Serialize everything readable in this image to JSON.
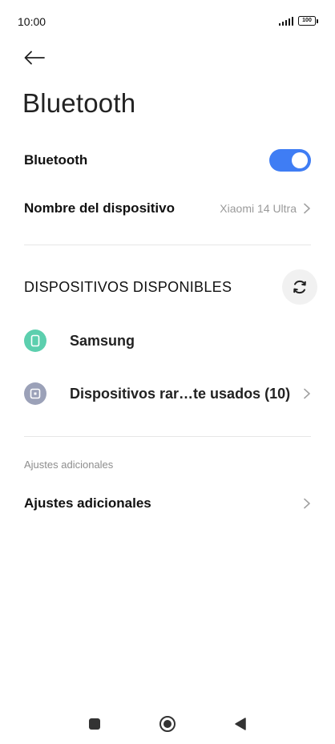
{
  "status_bar": {
    "time": "10:00",
    "battery": "100"
  },
  "header": {
    "title": "Bluetooth"
  },
  "bluetooth_toggle": {
    "label": "Bluetooth",
    "enabled": true,
    "accent": "#3f7df4"
  },
  "device_name_row": {
    "label": "Nombre del dispositivo",
    "value": "Xiaomi 14 Ultra"
  },
  "available_devices": {
    "title": "DISPOSITIVOS DISPONIBLES",
    "items": [
      {
        "name": "Samsung",
        "icon": "phone-icon",
        "color": "#5ccfae"
      },
      {
        "name": "Dispositivos rar…te usados (10)",
        "icon": "device-icon",
        "color": "#9ba1b8"
      }
    ]
  },
  "additional": {
    "caption": "Ajustes adicionales",
    "item_label": "Ajustes adicionales"
  }
}
